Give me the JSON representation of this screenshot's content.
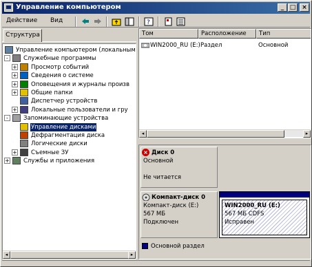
{
  "window": {
    "title": "Управление компьютером",
    "controls": {
      "minimize": "_",
      "maximize": "□",
      "close": "×"
    }
  },
  "menu": {
    "action": "Действие",
    "view": "Вид"
  },
  "toolbar": {
    "icons": [
      "back-arrow-icon",
      "forward-arrow-icon",
      "up-folder-icon",
      "console-tree-icon",
      "help-icon",
      "properties-icon",
      "export-icon"
    ]
  },
  "left": {
    "tab": "Структура",
    "tree": [
      {
        "label": "Управление компьютером (локальным)",
        "level": 0,
        "expander": "",
        "icon": "computer-icon"
      },
      {
        "label": "Служебные программы",
        "level": 1,
        "expander": "-",
        "icon": "tools-icon"
      },
      {
        "label": "Просмотр событий",
        "level": 2,
        "expander": "+",
        "icon": "event-viewer-icon"
      },
      {
        "label": "Сведения о системе",
        "level": 2,
        "expander": "+",
        "icon": "system-info-icon"
      },
      {
        "label": "Оповещения и журналы произв",
        "level": 2,
        "expander": "+",
        "icon": "alerts-icon"
      },
      {
        "label": "Общие папки",
        "level": 2,
        "expander": "+",
        "icon": "shared-folders-icon"
      },
      {
        "label": "Диспетчер устройств",
        "level": 2,
        "expander": "",
        "icon": "device-manager-icon"
      },
      {
        "label": "Локальные пользователи и гру",
        "level": 2,
        "expander": "+",
        "icon": "users-icon"
      },
      {
        "label": "Запоминающие устройства",
        "level": 1,
        "expander": "-",
        "icon": "storage-icon"
      },
      {
        "label": "Управление дисками",
        "level": 2,
        "expander": "",
        "icon": "disk-management-icon",
        "selected": true
      },
      {
        "label": "Дефрагментация диска",
        "level": 2,
        "expander": "",
        "icon": "defrag-icon"
      },
      {
        "label": "Логические диски",
        "level": 2,
        "expander": "",
        "icon": "logical-drives-icon"
      },
      {
        "label": "Съемные ЗУ",
        "level": 2,
        "expander": "+",
        "icon": "removable-storage-icon"
      },
      {
        "label": "Службы и приложения",
        "level": 1,
        "expander": "+",
        "icon": "services-icon"
      }
    ]
  },
  "list": {
    "columns": [
      "Том",
      "Расположение",
      "Тип"
    ],
    "rows": [
      {
        "volume": "WIN2000_RU (E:)",
        "location": "Раздел",
        "type": "Основной"
      }
    ]
  },
  "disks": {
    "disk0": {
      "name": "Диск 0",
      "type": "Основной",
      "status": "Не читается"
    },
    "cdrom0": {
      "name": "Компакт-диск 0",
      "drive": "Компакт-диск (E:)",
      "size": "567 МБ",
      "status": "Подключен"
    },
    "partition": {
      "label": "WIN2000_RU  (E:)",
      "detail": "567 МБ CDFS",
      "status": "Исправен"
    },
    "legend": "Основной раздел",
    "colors": {
      "primary": "#00007f",
      "selection": "#0a246a"
    }
  }
}
